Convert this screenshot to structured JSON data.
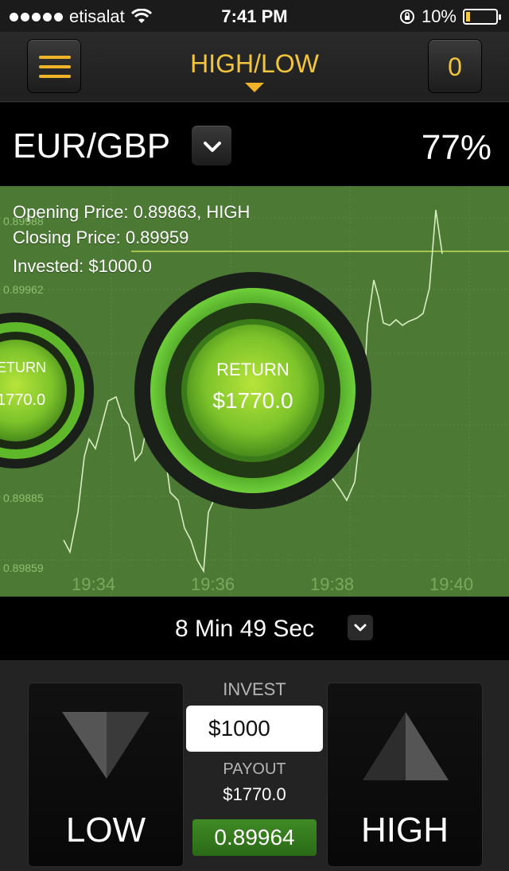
{
  "status_bar": {
    "carrier": "etisalat",
    "time": "7:41 PM",
    "battery": "10%"
  },
  "header": {
    "title": "HIGH/LOW",
    "count": "0"
  },
  "asset": {
    "name": "EUR/GBP",
    "payout_percent": "77%"
  },
  "chart_info": {
    "opening": "Opening Price: 0.89863, HIGH",
    "closing": "Closing Price: 0.89959",
    "invested": "Invested: $1000.0"
  },
  "return_bubbles": [
    {
      "label": "RETURN",
      "amount": "$1770.0"
    },
    {
      "label": "ETURN",
      "amount": "1770.0"
    }
  ],
  "chart_axis": {
    "y_ticks": [
      "0.89988",
      "0.89962",
      "0.89885",
      "0.89859"
    ],
    "x_ticks": [
      "19:34",
      "19:36",
      "19:38",
      "19:40"
    ]
  },
  "timer": {
    "label": "8 Min 49 Sec"
  },
  "trade": {
    "low_label": "LOW",
    "high_label": "HIGH",
    "invest_label": "INVEST",
    "invest_currency": "$",
    "invest_value": "1000",
    "payout_label": "PAYOUT",
    "payout_value": "$1770.0",
    "current_price": "0.89964"
  },
  "colors": {
    "accent": "#f2c53d",
    "chart_bg": "#4c7a34",
    "return_green": "#7bd62a"
  }
}
